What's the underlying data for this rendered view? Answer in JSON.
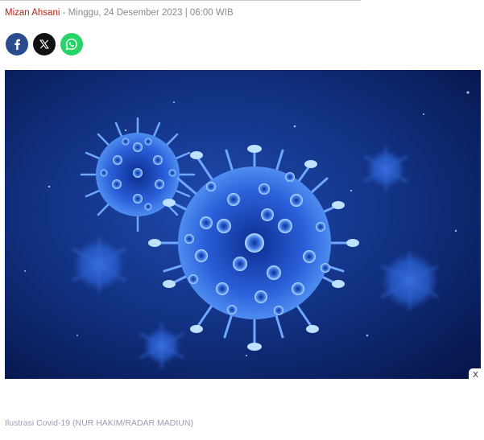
{
  "byline": {
    "author": "Mizan Ahsani",
    "date": " - Minggu, 24 Desember 2023 | 06:00 WIB"
  },
  "share": {
    "buttons": [
      {
        "icon": "facebook-icon",
        "color": "#2a4b8d"
      },
      {
        "icon": "x-twitter-icon",
        "color": "#111111"
      },
      {
        "icon": "whatsapp-icon",
        "color": "#25d366"
      }
    ]
  },
  "hero": {
    "subject": "blue virus particles illustration",
    "colors": {
      "background": "#0a1a52",
      "virus": "#2f6de0",
      "highlight": "#9fd0ff"
    }
  },
  "ad": {
    "close_label": "X"
  },
  "caption": "Ilustrasi Covid-19 (NUR HAKIM/RADAR MADIUN)"
}
